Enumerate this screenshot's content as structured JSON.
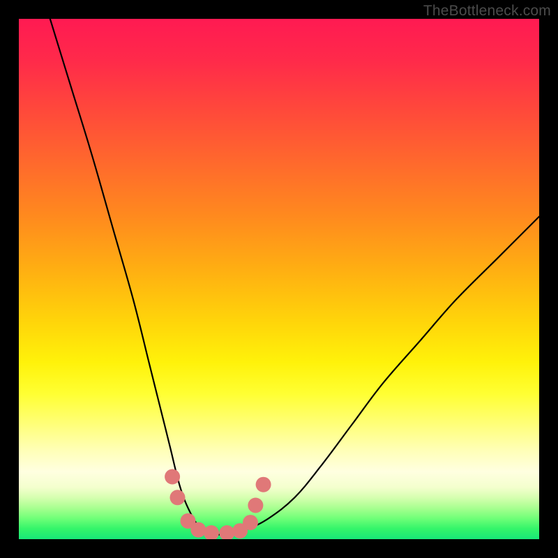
{
  "watermark": "TheBottleneck.com",
  "chart_data": {
    "type": "line",
    "title": "",
    "xlabel": "",
    "ylabel": "",
    "xlim": [
      0,
      100
    ],
    "ylim": [
      0,
      100
    ],
    "series": [
      {
        "name": "bottleneck-curve",
        "x": [
          6,
          10,
          14,
          18,
          22,
          25,
          27,
          29,
          31,
          33,
          35,
          37,
          40,
          44,
          48,
          53,
          58,
          64,
          70,
          77,
          84,
          92,
          100
        ],
        "y": [
          100,
          87,
          74,
          60,
          46,
          34,
          26,
          18,
          10,
          5,
          2,
          1,
          1,
          2,
          4,
          8,
          14,
          22,
          30,
          38,
          46,
          54,
          62
        ]
      }
    ],
    "markers": {
      "name": "highlight-dots",
      "color": "#e07878",
      "points": [
        {
          "x": 29.5,
          "y": 12
        },
        {
          "x": 30.5,
          "y": 8
        },
        {
          "x": 32.5,
          "y": 3.5
        },
        {
          "x": 34.5,
          "y": 1.8
        },
        {
          "x": 37,
          "y": 1.2
        },
        {
          "x": 40,
          "y": 1.2
        },
        {
          "x": 42.5,
          "y": 1.6
        },
        {
          "x": 44.5,
          "y": 3.2
        },
        {
          "x": 45.5,
          "y": 6.5
        },
        {
          "x": 47,
          "y": 10.5
        }
      ]
    },
    "gradient_stops": [
      {
        "pos": 0,
        "color": "#ff1a52"
      },
      {
        "pos": 50,
        "color": "#ffd40a"
      },
      {
        "pos": 80,
        "color": "#ffff7a"
      },
      {
        "pos": 100,
        "color": "#18e878"
      }
    ]
  }
}
